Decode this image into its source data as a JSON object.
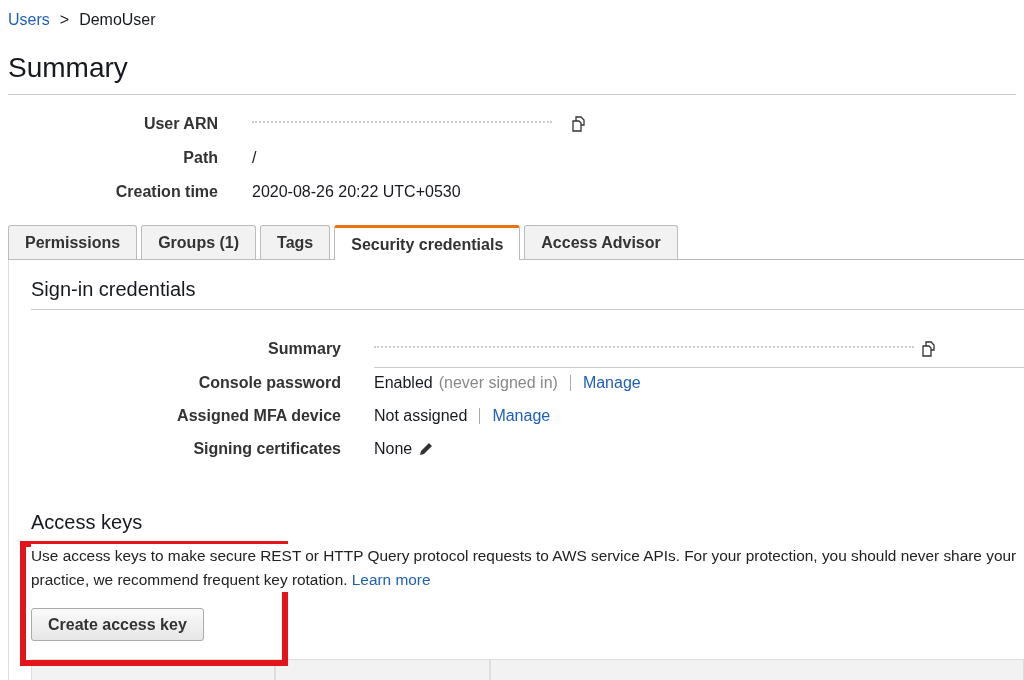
{
  "breadcrumb": {
    "link": "Users",
    "separator": ">",
    "current": "DemoUser"
  },
  "title": "Summary",
  "details": [
    {
      "label": "User ARN",
      "kind": "redacted"
    },
    {
      "label": "Path",
      "kind": "text",
      "value": "/"
    },
    {
      "label": "Creation time",
      "kind": "text",
      "value": "2020-08-26 20:22 UTC+0530"
    }
  ],
  "tabs": [
    {
      "label": "Permissions",
      "selected": false
    },
    {
      "label": "Groups (1)",
      "selected": false
    },
    {
      "label": "Tags",
      "selected": false
    },
    {
      "label": "Security credentials",
      "selected": true
    },
    {
      "label": "Access Advisor",
      "selected": false
    }
  ],
  "sign_in": {
    "heading": "Sign-in credentials",
    "rows": [
      {
        "label": "Summary",
        "kind": "redacted"
      },
      {
        "label": "Console password",
        "kind": "status",
        "value": "Enabled",
        "note": "(never signed in)",
        "link": "Manage"
      },
      {
        "label": "Assigned MFA device",
        "kind": "status",
        "value": "Not assigned",
        "link": "Manage"
      },
      {
        "label": "Signing certificates",
        "kind": "edit",
        "value": "None"
      }
    ]
  },
  "access_keys": {
    "heading": "Access keys",
    "lines": [
      {
        "text": "Use access keys to make secure REST or HTTP Query protocol requests to AWS service APIs. For your protection, you should never share your"
      },
      {
        "text": "practice, we recommend frequent key rotation.",
        "link": "Learn more"
      }
    ],
    "button": "Create access key"
  }
}
